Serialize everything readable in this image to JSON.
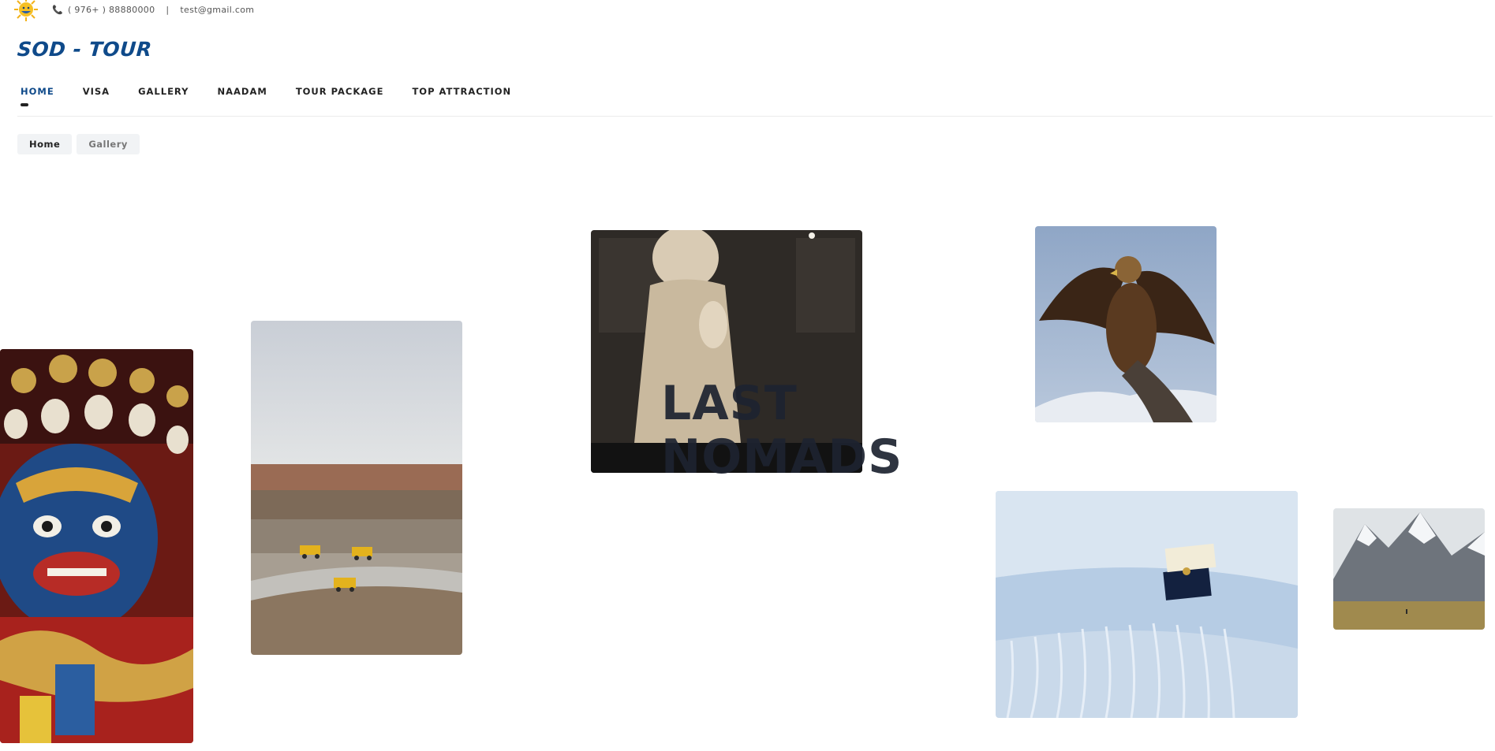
{
  "topbar": {
    "phone": "( 976+ ) 88880000",
    "separator": "|",
    "email": "test@gmail.com",
    "phone_icon": "phone-icon",
    "logo_icon": "sun-logo-icon"
  },
  "brand": {
    "name": "SOD - TOUR",
    "color": "#0f4a8a"
  },
  "nav": {
    "items": [
      {
        "label": "HOME",
        "active": true
      },
      {
        "label": "VISA"
      },
      {
        "label": "GALLERY"
      },
      {
        "label": "NAADAM"
      },
      {
        "label": "TOUR PACKAGE"
      },
      {
        "label": "TOP ATTRACTION"
      }
    ]
  },
  "breadcrumb": {
    "items": [
      "Home",
      "Gallery"
    ]
  },
  "hero": {
    "line1": "LAST",
    "line2": "NOMADS"
  },
  "gallery": {
    "images": [
      "mask-statue-photo",
      "mining-trucks-photo",
      "stone-statue-photo",
      "golden-eagle-photo",
      "cashmere-scarf-photo",
      "mountains-photo"
    ]
  }
}
